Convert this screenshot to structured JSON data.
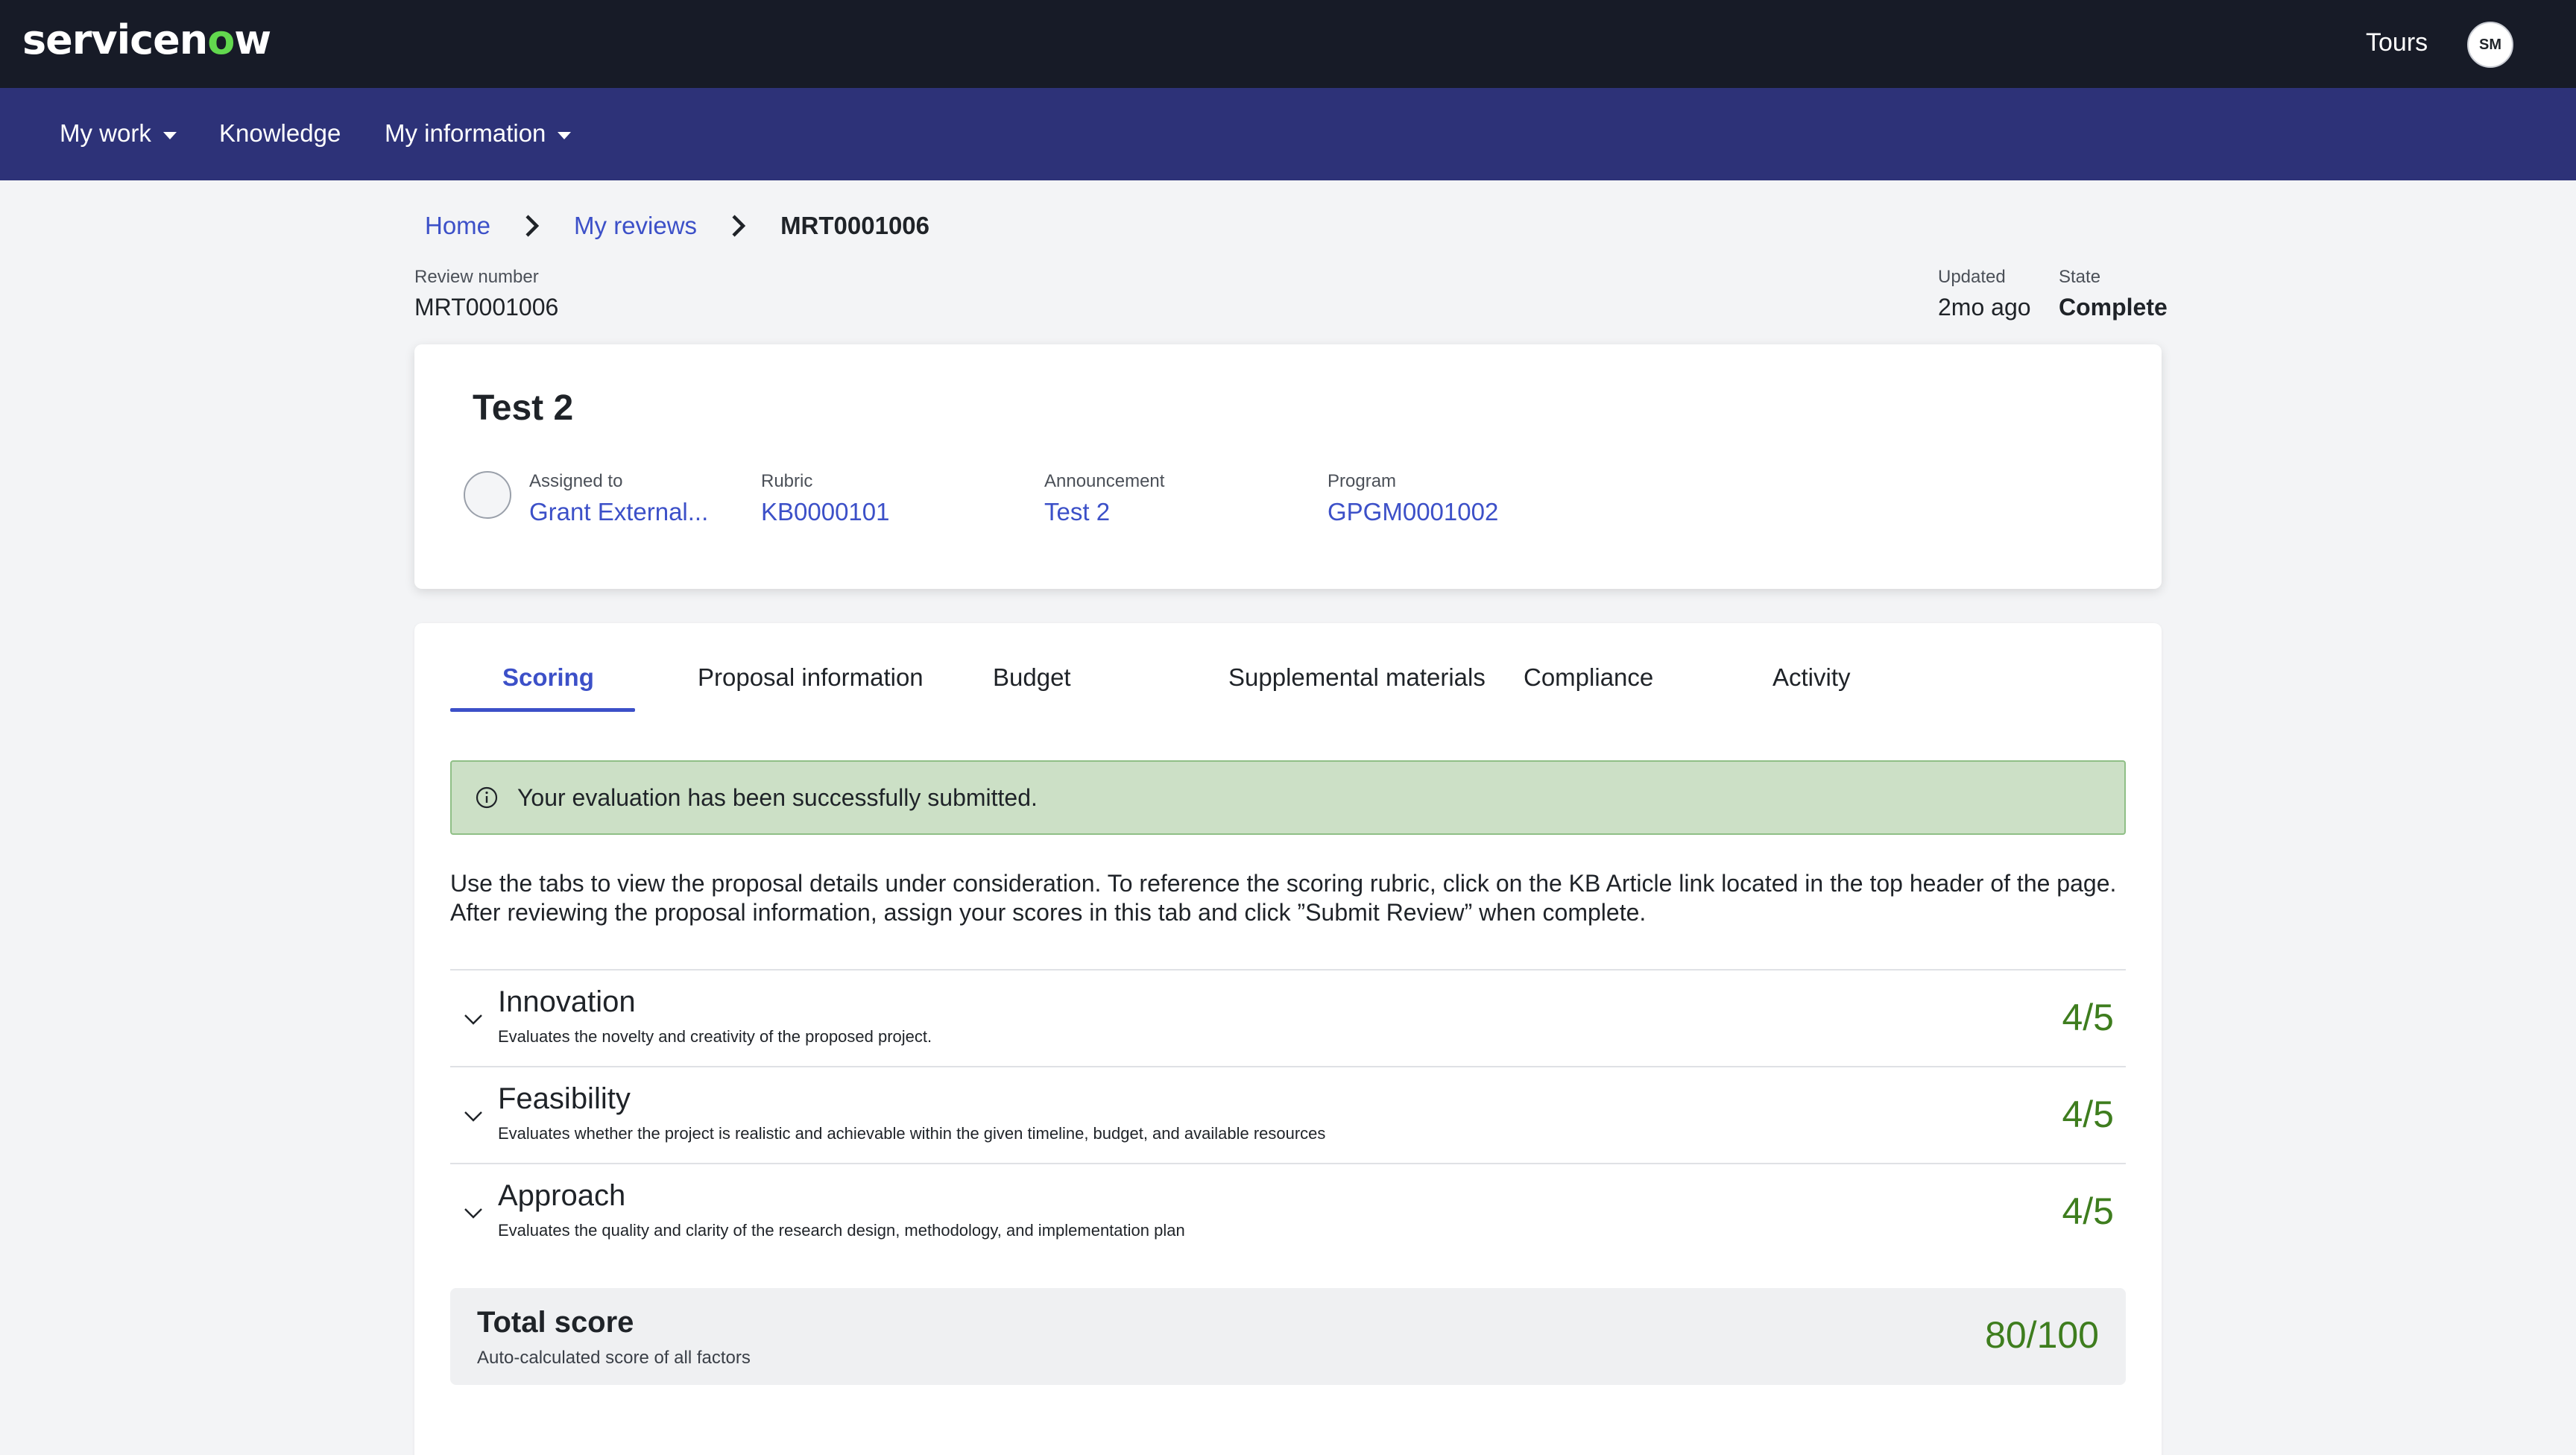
{
  "header": {
    "brand": {
      "prefix": "servicen",
      "o": "o",
      "suffix": "w"
    },
    "tours_label": "Tours",
    "user_initials": "SM"
  },
  "nav": {
    "items": [
      {
        "label": "My work",
        "has_dropdown": true
      },
      {
        "label": "Knowledge",
        "has_dropdown": false
      },
      {
        "label": "My information",
        "has_dropdown": true
      }
    ]
  },
  "breadcrumb": {
    "items": [
      "Home",
      "My reviews"
    ],
    "current": "MRT0001006"
  },
  "review": {
    "number_label": "Review number",
    "number": "MRT0001006",
    "updated_label": "Updated",
    "updated": "2mo ago",
    "state_label": "State",
    "state": "Complete"
  },
  "summary_card": {
    "title": "Test 2",
    "assigned_label": "Assigned to",
    "assigned_value": "Grant External...",
    "rubric_label": "Rubric",
    "rubric_value": "KB0000101",
    "announcement_label": "Announcement",
    "announcement_value": "Test 2",
    "program_label": "Program",
    "program_value": "GPGM0001002"
  },
  "tabs": [
    {
      "label": "Scoring",
      "active": true
    },
    {
      "label": "Proposal information",
      "active": false
    },
    {
      "label": "Budget",
      "active": false
    },
    {
      "label": "Supplemental materials",
      "active": false
    },
    {
      "label": "Compliance",
      "active": false
    },
    {
      "label": "Activity",
      "active": false
    }
  ],
  "alert": {
    "text": "Your evaluation has been successfully submitted.",
    "icon": "info-icon"
  },
  "instructions": "Use the tabs to view the proposal details under consideration. To reference the scoring rubric, click on the KB Article link located in the top header of the page. After reviewing the proposal information, assign your scores in this tab and click ”Submit Review” when complete.",
  "criteria": [
    {
      "name": "Innovation",
      "description": "Evaluates the novelty and creativity of the proposed project.",
      "score": "4/5"
    },
    {
      "name": "Feasibility",
      "description": "Evaluates whether the project is realistic and achievable within the given timeline, budget, and available resources",
      "score": "4/5"
    },
    {
      "name": "Approach",
      "description": "Evaluates the quality and clarity of the research design, methodology, and implementation plan",
      "score": "4/5"
    }
  ],
  "total": {
    "name": "Total score",
    "description": "Auto-calculated score of all factors",
    "score": "80/100"
  },
  "colors": {
    "topbar": "#171b27",
    "navbar": "#2d3278",
    "link": "#3c50c8",
    "score_green": "#3e7d1e",
    "alert_bg": "#cce0c6",
    "brand_accent": "#62d84e"
  }
}
